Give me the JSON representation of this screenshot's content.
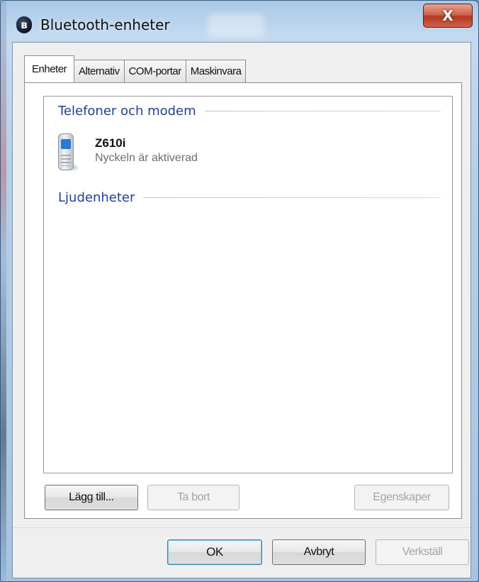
{
  "window": {
    "title": "Bluetooth-enheter",
    "close_glyph": "X"
  },
  "tabs": [
    {
      "label": "Enheter",
      "active": true
    },
    {
      "label": "Alternativ",
      "active": false
    },
    {
      "label": "COM-portar",
      "active": false
    },
    {
      "label": "Maskinvara",
      "active": false
    }
  ],
  "devices": {
    "groups": [
      {
        "header": "Telefoner och modem",
        "items": [
          {
            "name": "Z610i",
            "status": "Nyckeln är aktiverad",
            "icon": "mobile-phone-icon"
          }
        ]
      },
      {
        "header": "Ljudenheter",
        "items": []
      }
    ]
  },
  "panel_buttons": {
    "add": "Lägg till...",
    "remove": "Ta bort",
    "properties": "Egenskaper"
  },
  "dialog_buttons": {
    "ok": "OK",
    "cancel": "Avbryt",
    "apply": "Verkställ"
  },
  "colors": {
    "group_header": "#1f3f9a",
    "close_button": "#c9452b",
    "default_button_border": "#3c7fb1"
  }
}
